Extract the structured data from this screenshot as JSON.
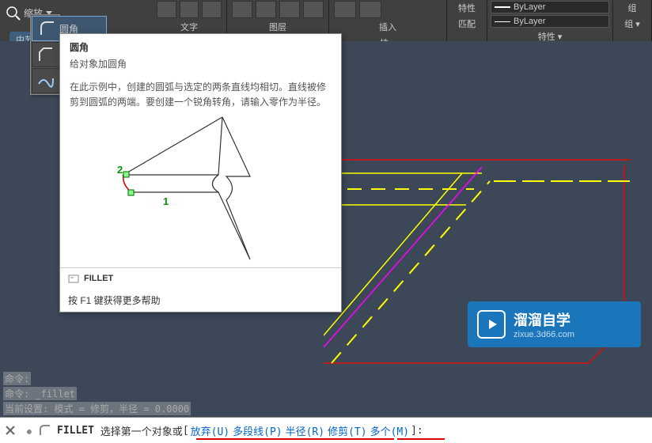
{
  "ribbon": {
    "zoom_label": "缩放",
    "text_label": "文字",
    "layer_label": "图层",
    "insert_label": "插入",
    "props_label": "特性",
    "match_label": "匹配",
    "group_label": "组",
    "block_label": "块 ▾",
    "props_panel_label": "特性 ▾",
    "group_panel_label": "组 ▾",
    "bylayer1": "ByLayer",
    "bylayer2": "ByLayer"
  },
  "middle_tab": "中节",
  "tooltip": {
    "selected_label": "圆角",
    "title": "圆角",
    "subtitle": "给对象加圆角",
    "body": "在此示例中，创建的圆弧与选定的两条直线均相切。直线被修剪到圆弧的两端。要创建一个锐角转角，请输入零作为半径。",
    "diagram_label_1": "1",
    "diagram_label_2": "2",
    "footer_cmd": "FILLET",
    "help": "按 F1 键获得更多帮助"
  },
  "cmd_history": {
    "line1": "命令:",
    "line2": "命令: _fillet",
    "line3": "当前设置: 模式 = 修剪，半径 = 0.0000"
  },
  "cmd_bar": {
    "cmd": "FILLET",
    "prompt": "选择第一个对象或 ",
    "opt_undo": "放弃(U)",
    "opt_pline": "多段线(P)",
    "opt_radius": "半径(R)",
    "opt_trim": "修剪(T)",
    "opt_multi": "多个(M)",
    "end": "]:"
  },
  "watermark": {
    "text1": "溜溜自学",
    "text2": "zixue.3d66.com"
  }
}
